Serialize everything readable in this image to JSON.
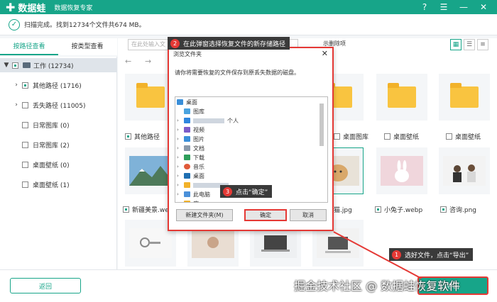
{
  "app": {
    "name": "数据蛙",
    "subtitle": "数据恢复专家",
    "status": "扫描完成。找到12734个文件共674 MB。"
  },
  "window_controls": {
    "help": "?",
    "menu": "☰",
    "minimize": "—",
    "close": "✕"
  },
  "tabs": [
    "按路径查看",
    "按类型查看"
  ],
  "sidebar": {
    "root": "工作 (12734)",
    "items": [
      {
        "label": "其他路径 (1716)",
        "expandable": true
      },
      {
        "label": "丢失路径 (11005)",
        "expandable": true
      },
      {
        "label": "日常图库 (0)",
        "expandable": false
      },
      {
        "label": "日常图库 (2)",
        "expandable": false
      },
      {
        "label": "桌面壁纸 (0)",
        "expandable": false
      },
      {
        "label": "桌面壁纸 (1)",
        "expandable": false
      }
    ]
  },
  "search": {
    "placeholder": "在此处输入文"
  },
  "toolbar": {
    "show_deleted": "示删除项"
  },
  "tiles": {
    "row1_labels": [
      "其他路径",
      "桌面图库",
      "桌面壁纸",
      "桌面壁纸"
    ],
    "row2_labels": [
      "新疆美景.we",
      "猫.jpg",
      "小兔子.webp",
      "咨询.png"
    ]
  },
  "dialog": {
    "title": "浏览文件夹",
    "description": "请你将需要恢复的文件保存到原丢失数据的磁盘。",
    "tree": [
      {
        "label": "桌面",
        "level": 0
      },
      {
        "label": "图库",
        "level": 1
      },
      {
        "label": "个人",
        "level": 1
      },
      {
        "label": "视频",
        "level": 1
      },
      {
        "label": "图片",
        "level": 1
      },
      {
        "label": "文档",
        "level": 1
      },
      {
        "label": "下载",
        "level": 1
      },
      {
        "label": "音乐",
        "level": 1
      },
      {
        "label": "桌面",
        "level": 1
      },
      {
        "label": "",
        "level": 1
      },
      {
        "label": "此电脑",
        "level": 1
      },
      {
        "label": "库",
        "level": 1
      }
    ],
    "new_folder": "新建文件夹(M)",
    "ok": "确定",
    "cancel": "取消"
  },
  "callouts": {
    "c1_num": "1",
    "c1_text": "选好文件，点击“导出”",
    "c2_num": "2",
    "c2_text": "在此弹窗选择恢复文件的新存储路径",
    "c3_num": "3",
    "c3_text": "点击“确定”"
  },
  "buttons": {
    "back": "返回",
    "export": "导出"
  },
  "watermark": "掘金技术社区 @ 数据蛙恢复软件",
  "colors": {
    "accent": "#17a589",
    "highlight": "#e53935",
    "callout_bg": "#3a3a3a"
  }
}
